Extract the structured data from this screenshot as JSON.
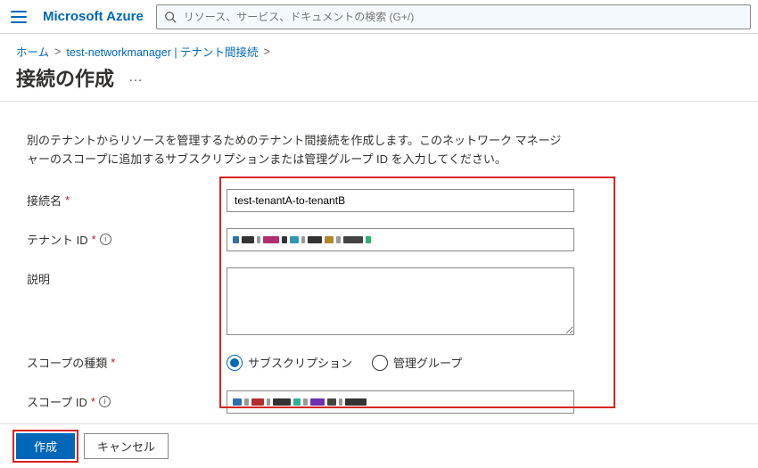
{
  "header": {
    "brand": "Microsoft Azure",
    "search_placeholder": "リソース、サービス、ドキュメントの検索 (G+/)"
  },
  "breadcrumb": {
    "items": [
      "ホーム",
      "test-networkmanager | テナント間接続"
    ]
  },
  "page": {
    "title": "接続の作成",
    "description": "別のテナントからリソースを管理するためのテナント間接続を作成します。このネットワーク マネージャーのスコープに追加するサブスクリプションまたは管理グループ ID を入力してください。"
  },
  "form": {
    "name": {
      "label": "接続名",
      "required": true,
      "value": "test-tenantA-to-tenantB"
    },
    "tenant_id": {
      "label": "テナント ID",
      "required": true,
      "info": true,
      "masked": true
    },
    "description": {
      "label": "説明",
      "value": ""
    },
    "scope_type": {
      "label": "スコープの種類",
      "required": true,
      "options": [
        "サブスクリプション",
        "管理グループ"
      ],
      "selected": "サブスクリプション"
    },
    "scope_id": {
      "label": "スコープ ID",
      "required": true,
      "info": true,
      "masked": true
    }
  },
  "footer": {
    "create": "作成",
    "cancel": "キャンセル"
  },
  "colors": {
    "accent": "#0067b8",
    "annotation": "#d6261f",
    "required": "#a4262c"
  }
}
